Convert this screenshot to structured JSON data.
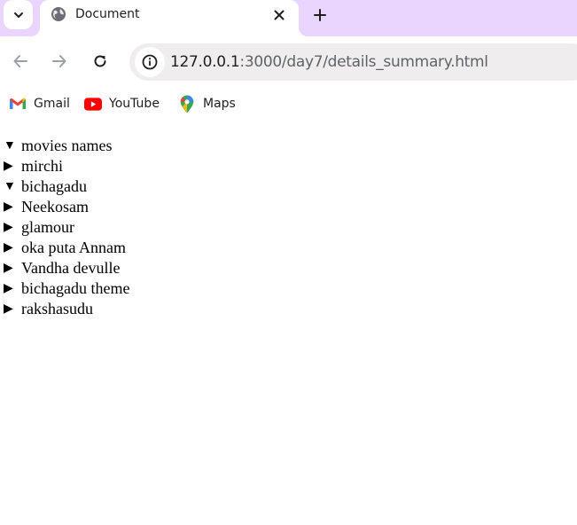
{
  "browser": {
    "tab": {
      "title": "Document",
      "favicon": "globe-icon"
    },
    "toolbar": {
      "url_host": "127.0.0.1",
      "url_rest": ":3000/day7/details_summary.html"
    },
    "bookmarks": [
      {
        "label": "Gmail",
        "icon": "gmail-icon"
      },
      {
        "label": "YouTube",
        "icon": "youtube-icon"
      },
      {
        "label": "Maps",
        "icon": "maps-icon"
      }
    ],
    "colors": {
      "tabstrip": "#e9d5ff",
      "omnibox": "#efeded"
    }
  },
  "page": {
    "details": [
      {
        "summary": "movies names",
        "open": true,
        "marker": "▼"
      },
      {
        "summary": "mirchi",
        "open": false,
        "marker": "▶"
      },
      {
        "summary": "bichagadu",
        "open": true,
        "marker": "▼"
      },
      {
        "summary": "Neekosam",
        "open": false,
        "marker": "▶"
      },
      {
        "summary": "glamour",
        "open": false,
        "marker": "▶"
      },
      {
        "summary": "oka puta Annam",
        "open": false,
        "marker": "▶"
      },
      {
        "summary": "Vandha devulle",
        "open": false,
        "marker": "▶"
      },
      {
        "summary": "bichagadu theme",
        "open": false,
        "marker": "▶"
      },
      {
        "summary": "rakshasudu",
        "open": false,
        "marker": "▶"
      }
    ]
  }
}
